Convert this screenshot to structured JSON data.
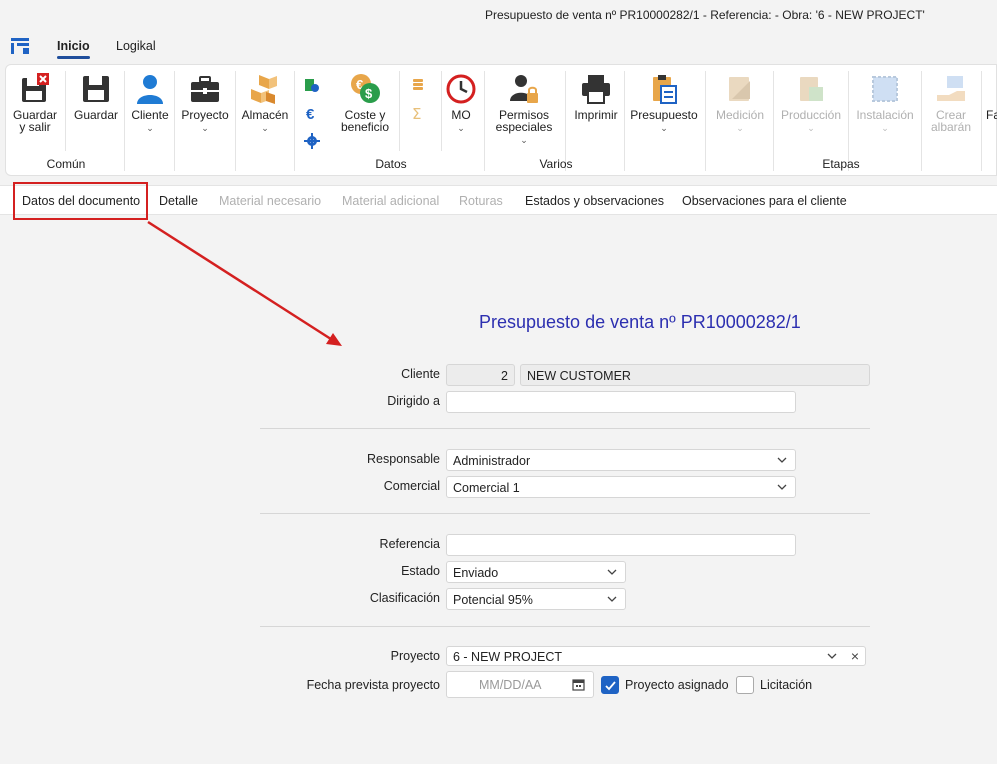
{
  "window": {
    "title": "Presupuesto de venta nº PR10000282/1 - Referencia:  - Obra: '6 - NEW PROJECT'"
  },
  "menu": {
    "tabs": [
      {
        "label": "Inicio",
        "active": true
      },
      {
        "label": "Logikal",
        "active": false
      }
    ]
  },
  "ribbon": {
    "buttons": {
      "guardar_salir": "Guardar y salir",
      "guardar": "Guardar",
      "cliente": "Cliente",
      "proyecto": "Proyecto",
      "almacen": "Almacén",
      "coste_beneficio": "Coste y beneficio",
      "mo": "MO",
      "permisos_especiales": "Permisos especiales",
      "imprimir": "Imprimir",
      "presupuesto": "Presupuesto",
      "medicion": "Medición",
      "produccion": "Producción",
      "instalacion": "Instalación",
      "crear_albaran": "Crear albarán",
      "cut_off": "Fa"
    },
    "groups": {
      "comun": "Común",
      "datos": "Datos",
      "varios": "Varios",
      "etapas": "Etapas"
    }
  },
  "doc_tabs": [
    {
      "label": "Datos del documento",
      "enabled": true,
      "highlighted": true
    },
    {
      "label": "Detalle",
      "enabled": true
    },
    {
      "label": "Material necesario",
      "enabled": false
    },
    {
      "label": "Material adicional",
      "enabled": false
    },
    {
      "label": "Roturas",
      "enabled": false
    },
    {
      "label": "Estados y observaciones",
      "enabled": true
    },
    {
      "label": "Observaciones para el cliente",
      "enabled": true
    }
  ],
  "form": {
    "title": "Presupuesto de venta nº PR10000282/1",
    "cliente": {
      "label": "Cliente",
      "code": "2",
      "name": "NEW CUSTOMER"
    },
    "dirigido_a": {
      "label": "Dirigido a",
      "value": ""
    },
    "responsable": {
      "label": "Responsable",
      "value": "Administrador"
    },
    "comercial": {
      "label": "Comercial",
      "value": "Comercial 1"
    },
    "referencia": {
      "label": "Referencia",
      "value": ""
    },
    "estado": {
      "label": "Estado",
      "value": "Enviado"
    },
    "clasificacion": {
      "label": "Clasificación",
      "value": "Potencial 95%"
    },
    "proyecto": {
      "label": "Proyecto",
      "value": "6 -  NEW PROJECT"
    },
    "fecha_prevista": {
      "label": "Fecha prevista proyecto",
      "placeholder": "MM/DD/AA",
      "value": ""
    },
    "proyecto_asignado": {
      "label": "Proyecto asignado",
      "checked": true
    },
    "licitacion": {
      "label": "Licitación",
      "checked": false
    }
  },
  "colors": {
    "accent": "#1f4e9c",
    "title_blue": "#2c2fb0",
    "highlight_red": "#d42020",
    "checkbox_blue": "#1f63c4"
  }
}
